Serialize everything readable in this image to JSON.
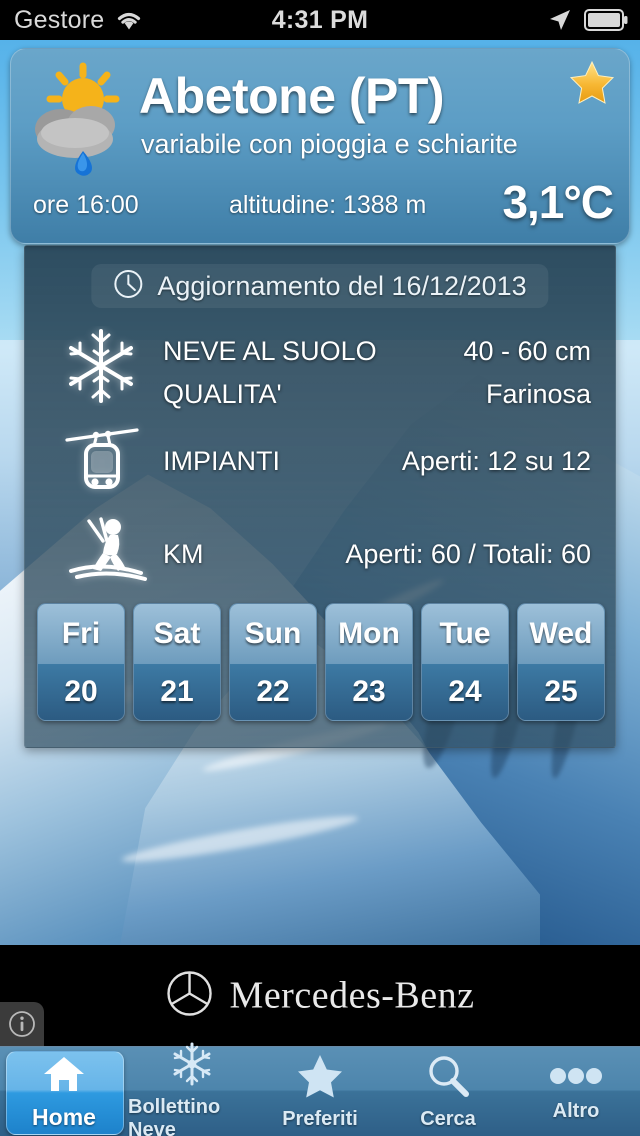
{
  "statusbar": {
    "carrier": "Gestore",
    "time": "4:31 PM",
    "wifi_icon": "wifi-icon",
    "location_icon": "location-arrow-icon",
    "battery_icon": "battery-icon"
  },
  "header_card": {
    "weather_icon": "sun-cloud-rain-icon",
    "location_name": "Abetone (PT)",
    "conditions": "variabile con pioggia e schiarite",
    "favorite_icon": "star-icon",
    "hour": "ore 16:00",
    "altitude": "altitudine: 1388 m",
    "temperature": "3,1°C",
    "accent_color": "#5c9dc5",
    "star_color": "#f5a623"
  },
  "panel": {
    "update_icon": "clock-icon",
    "update_text": "Aggiornamento del 16/12/2013",
    "stats": [
      {
        "icon": "snowflake-icon",
        "rows": [
          {
            "label": "NEVE AL SUOLO",
            "value": "40 - 60 cm"
          },
          {
            "label": "QUALITA'",
            "value": "Farinosa"
          }
        ]
      },
      {
        "icon": "gondola-icon",
        "rows": [
          {
            "label": "IMPIANTI",
            "value": "Aperti: 12 su 12"
          }
        ]
      },
      {
        "icon": "skier-icon",
        "rows": [
          {
            "label": "KM",
            "value": "Aperti: 60 / Totali: 60"
          }
        ]
      }
    ],
    "days": [
      {
        "day": "Fri",
        "date": "20"
      },
      {
        "day": "Sat",
        "date": "21"
      },
      {
        "day": "Sun",
        "date": "22"
      },
      {
        "day": "Mon",
        "date": "23"
      },
      {
        "day": "Tue",
        "date": "24"
      },
      {
        "day": "Wed",
        "date": "25"
      }
    ]
  },
  "ad": {
    "logo_icon": "mercedes-benz-star-icon",
    "brand": "Mercedes-Benz",
    "info_icon": "info-icon"
  },
  "tabbar": {
    "items": [
      {
        "label": "Home",
        "icon": "home-icon",
        "active": true
      },
      {
        "label": "Bollettino Neve",
        "icon": "snowflake-icon",
        "active": false
      },
      {
        "label": "Preferiti",
        "icon": "star-icon",
        "active": false
      },
      {
        "label": "Cerca",
        "icon": "search-icon",
        "active": false
      },
      {
        "label": "Altro",
        "icon": "ellipsis-icon",
        "active": false
      }
    ]
  }
}
